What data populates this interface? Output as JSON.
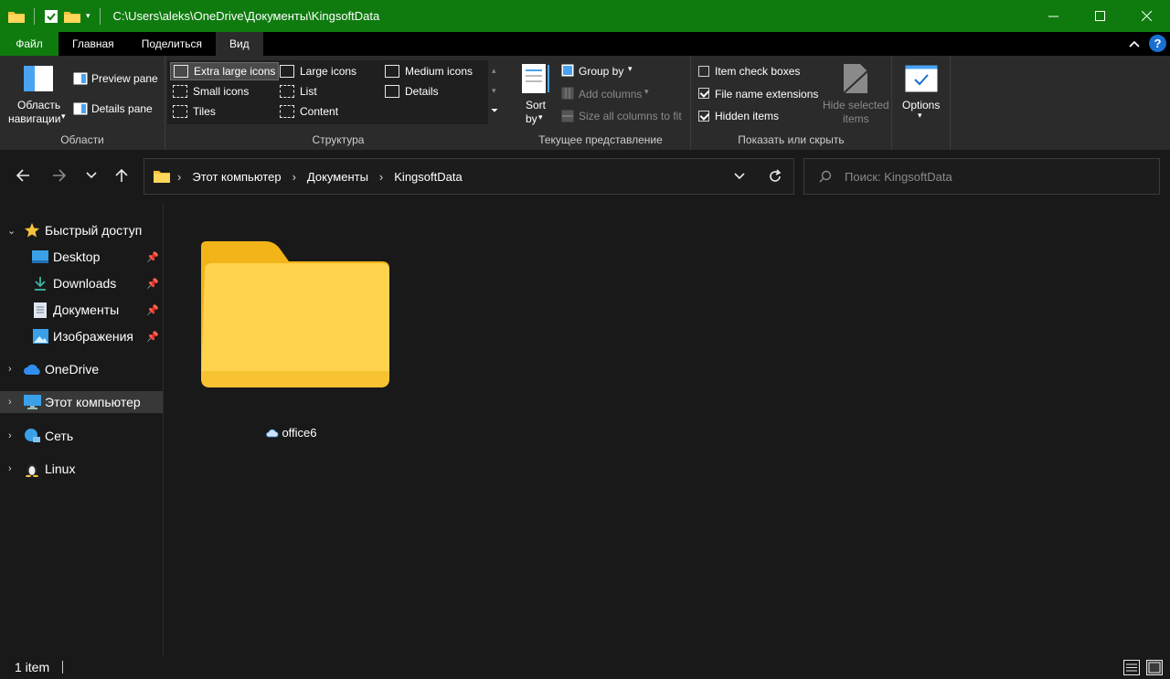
{
  "window": {
    "title": "C:\\Users\\aleks\\OneDrive\\Документы\\KingsoftData",
    "colors": {
      "titlebar": "#0f7b0f",
      "background": "#191919",
      "ribbon": "#2b2b2b",
      "accent": "#1a6fd1"
    }
  },
  "tabs": [
    {
      "label": "Файл"
    },
    {
      "label": "Главная"
    },
    {
      "label": "Поделиться"
    },
    {
      "label": "Вид"
    }
  ],
  "ribbon": {
    "panes": {
      "nav_pane_line1": "Область",
      "nav_pane_line2": "навигации",
      "preview_pane": "Preview pane",
      "details_pane": "Details pane",
      "group_label": "Области"
    },
    "layout": {
      "items": [
        "Extra large icons",
        "Large icons",
        "Medium icons",
        "Small icons",
        "List",
        "Details",
        "Tiles",
        "Content"
      ],
      "selected": "Extra large icons",
      "group_label": "Структура"
    },
    "current_view": {
      "sort_line1": "Sort",
      "sort_line2": "by",
      "group_by": "Group by",
      "add_columns": "Add columns",
      "size_columns": "Size all columns to fit",
      "group_label": "Текущее представление"
    },
    "show_hide": {
      "item_check_boxes": "Item check boxes",
      "item_check_boxes_checked": false,
      "file_name_extensions": "File name extensions",
      "file_name_extensions_checked": true,
      "hidden_items": "Hidden items",
      "hidden_items_checked": true,
      "hide_selected_line1": "Hide selected",
      "hide_selected_line2": "items",
      "group_label": "Показать или скрыть"
    },
    "options": {
      "label": "Options"
    }
  },
  "address": {
    "crumbs": [
      "Этот компьютер",
      "Документы",
      "KingsoftData"
    ],
    "search_placeholder": "Поиск: KingsoftData"
  },
  "sidebar": {
    "quick_access": "Быстрый доступ",
    "items": [
      {
        "label": "Desktop",
        "icon": "desktop-icon"
      },
      {
        "label": "Downloads",
        "icon": "download-icon"
      },
      {
        "label": "Документы",
        "icon": "document-icon"
      },
      {
        "label": "Изображения",
        "icon": "pictures-icon"
      }
    ],
    "onedrive": "OneDrive",
    "this_pc": "Этот компьютер",
    "network": "Сеть",
    "linux": "Linux"
  },
  "content": {
    "items": [
      {
        "name": "office6",
        "type": "folder",
        "status": "cloud-icon"
      }
    ]
  },
  "status": {
    "count": "1 item"
  }
}
